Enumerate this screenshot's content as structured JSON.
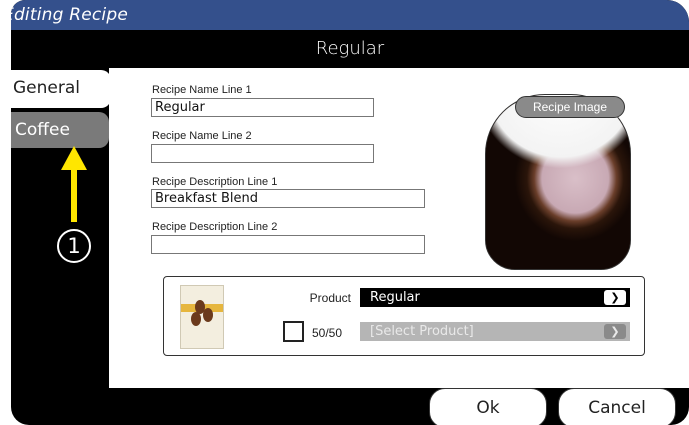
{
  "window": {
    "title": "Editing Recipe"
  },
  "header": {
    "title": "Regular"
  },
  "tabs": [
    {
      "label": "General",
      "active": true
    },
    {
      "label": "Coffee",
      "active": false
    }
  ],
  "form": {
    "name_line1": {
      "label": "Recipe Name Line 1",
      "value": "Regular"
    },
    "name_line2": {
      "label": "Recipe Name Line 2",
      "value": ""
    },
    "desc_line1": {
      "label": "Recipe Description Line 1",
      "value": "Breakfast Blend"
    },
    "desc_line2": {
      "label": "Recipe Description Line 2",
      "value": ""
    }
  },
  "recipe_image": {
    "button_label": "Recipe Image"
  },
  "product": {
    "label": "Product",
    "selected": "Regular",
    "fifty_fifty": {
      "label": "50/50",
      "checked": false,
      "selected": "[Select Product]"
    }
  },
  "buttons": {
    "ok": "Ok",
    "cancel": "Cancel"
  },
  "annotation": {
    "number": "1",
    "color": "#ffe600"
  },
  "colors": {
    "titlebar": "#34508c",
    "active_tab": "#ffffff",
    "inactive_tab": "#7a7a7a"
  }
}
